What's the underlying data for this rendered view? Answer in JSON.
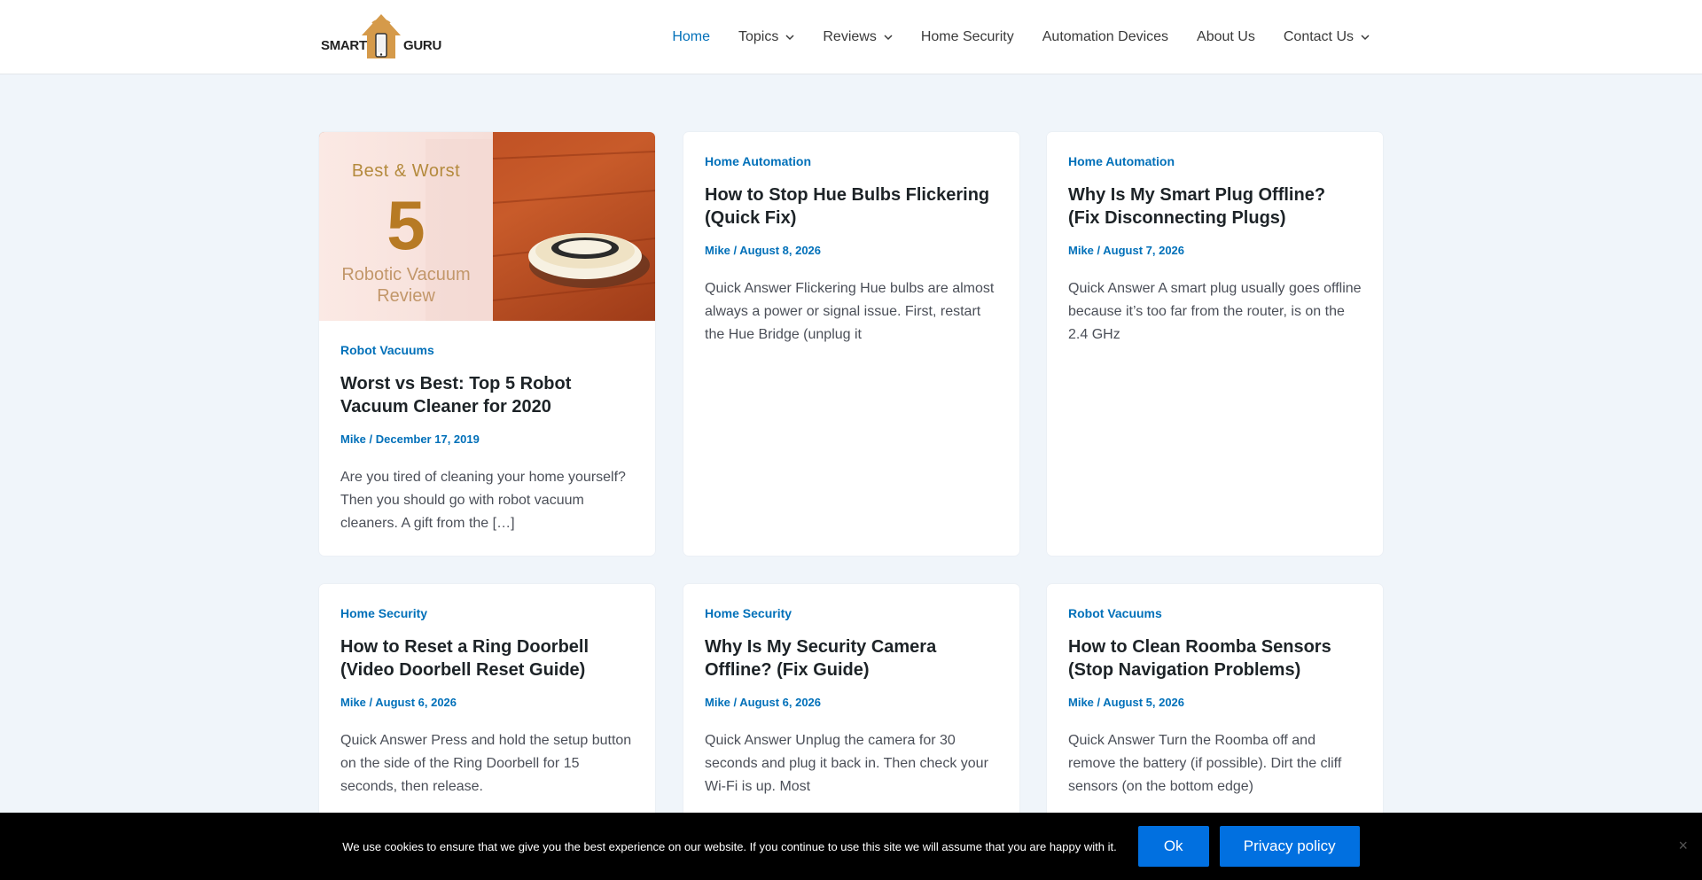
{
  "header": {
    "logo": {
      "left": "SMART",
      "right": "GURU"
    },
    "nav": [
      {
        "label": "Home",
        "active": true,
        "dropdown": false
      },
      {
        "label": "Topics",
        "active": false,
        "dropdown": true
      },
      {
        "label": "Reviews",
        "active": false,
        "dropdown": true
      },
      {
        "label": "Home Security",
        "active": false,
        "dropdown": false
      },
      {
        "label": "Automation Devices",
        "active": false,
        "dropdown": false
      },
      {
        "label": "About Us",
        "active": false,
        "dropdown": false
      },
      {
        "label": "Contact Us",
        "active": false,
        "dropdown": true
      }
    ]
  },
  "featured_image": {
    "line1": "Best & Worst",
    "number": "5",
    "line2": "Robotic Vacuum",
    "line3": "Review"
  },
  "posts": [
    {
      "category": "Robot Vacuums",
      "title": "Worst vs Best: Top 5 Robot Vacuum Cleaner for 2020",
      "author": "Mike",
      "date": "December 17, 2019",
      "excerpt": "Are you tired of cleaning your home yourself? Then you should go with robot vacuum cleaners. A gift from the […]"
    },
    {
      "category": "Home Automation",
      "title": "How to Stop Hue Bulbs Flickering (Quick Fix)",
      "author": "Mike",
      "date": "August 8, 2026",
      "excerpt": "Quick Answer Flickering Hue bulbs are almost always a power or signal issue. First, restart the Hue Bridge (unplug it"
    },
    {
      "category": "Home Automation",
      "title": "Why Is My Smart Plug Offline? (Fix Disconnecting Plugs)",
      "author": "Mike",
      "date": "August 7, 2026",
      "excerpt": "Quick Answer A smart plug usually goes offline because it’s too far from the router, is on the 2.4 GHz"
    },
    {
      "category": "Home Security",
      "title": "How to Reset a Ring Doorbell (Video Doorbell Reset Guide)",
      "author": "Mike",
      "date": "August 6, 2026",
      "excerpt": "Quick Answer Press and hold the setup button on the side of the Ring Doorbell for 15 seconds, then release."
    },
    {
      "category": "Home Security",
      "title": "Why Is My Security Camera Offline? (Fix Guide)",
      "author": "Mike",
      "date": "August 6, 2026",
      "excerpt": "Quick Answer Unplug the camera for 30 seconds and plug it back in. Then check your Wi-Fi is up. Most"
    },
    {
      "category": "Robot Vacuums",
      "title": "How to Clean Roomba Sensors (Stop Navigation Problems)",
      "author": "Mike",
      "date": "August 5, 2026",
      "excerpt": "Quick Answer Turn the Roomba off and remove the battery (if possible). Dirt the cliff sensors (on the bottom edge)"
    }
  ],
  "meta_separator": " / ",
  "cookie": {
    "text": "We use cookies to ensure that we give you the best experience on our website. If you continue to use this site we will assume that you are happy with it.",
    "ok_label": "Ok",
    "privacy_label": "Privacy policy",
    "close_glyph": "×"
  },
  "colors": {
    "accent": "#0170b9",
    "page_bg": "#f0f5fa",
    "cookie_bg": "#000000",
    "button_bg": "#0170e0"
  }
}
